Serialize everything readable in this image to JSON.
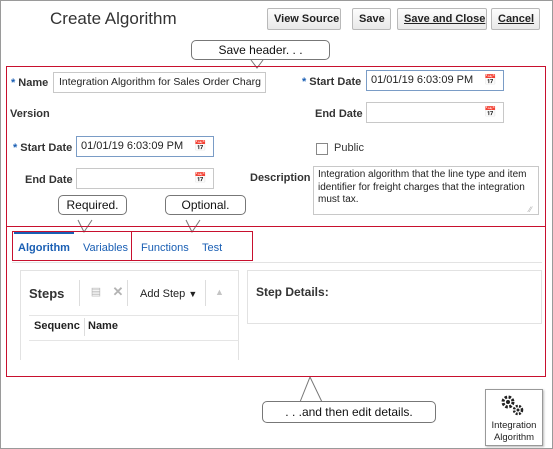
{
  "page": {
    "title": "Create Algorithm",
    "toolbar": {
      "view_source": "View Source",
      "save": "Save",
      "save_close": "Save and Close",
      "cancel": "Cancel"
    }
  },
  "callouts": {
    "save_header": "Save header. . .",
    "required": "Required.",
    "optional": "Optional.",
    "then_edit": ". . .and then edit details."
  },
  "header_form": {
    "name_label": "Name",
    "name_value": "Integration Algorithm for Sales Order Charg",
    "version_label": "Version",
    "start_date_label": "Start Date",
    "start_date_value": "01/01/19 6:03:09 PM",
    "end_date_label": "End Date",
    "end_date_value": "",
    "right_start_date_label": "Start Date",
    "right_start_date_value": "01/01/19 6:03:09 PM",
    "right_end_date_label": "End Date",
    "right_end_date_value": "",
    "public_label": "Public",
    "public_checked": false,
    "description_label": "Description",
    "description_value": "Integration algorithm that the line type and item identifier for freight charges that the integration must tax.",
    "required_marker": "*"
  },
  "tabs": [
    {
      "label": "Algorithm",
      "selected": true
    },
    {
      "label": "Variables",
      "selected": false
    },
    {
      "label": "Functions",
      "selected": false
    },
    {
      "label": "Test",
      "selected": false
    }
  ],
  "steps_panel": {
    "title": "Steps",
    "add_step": "Add Step",
    "columns": [
      "Sequenc",
      "Name"
    ]
  },
  "step_details": {
    "title": "Step Details:"
  },
  "side_button": {
    "line1": "Integration",
    "line2": "Algorithm",
    "icon": "gears-icon"
  },
  "colors": {
    "highlight_box": "#c8102e",
    "link": "#1a5fb4",
    "required_marker": "#1a5fb4"
  }
}
